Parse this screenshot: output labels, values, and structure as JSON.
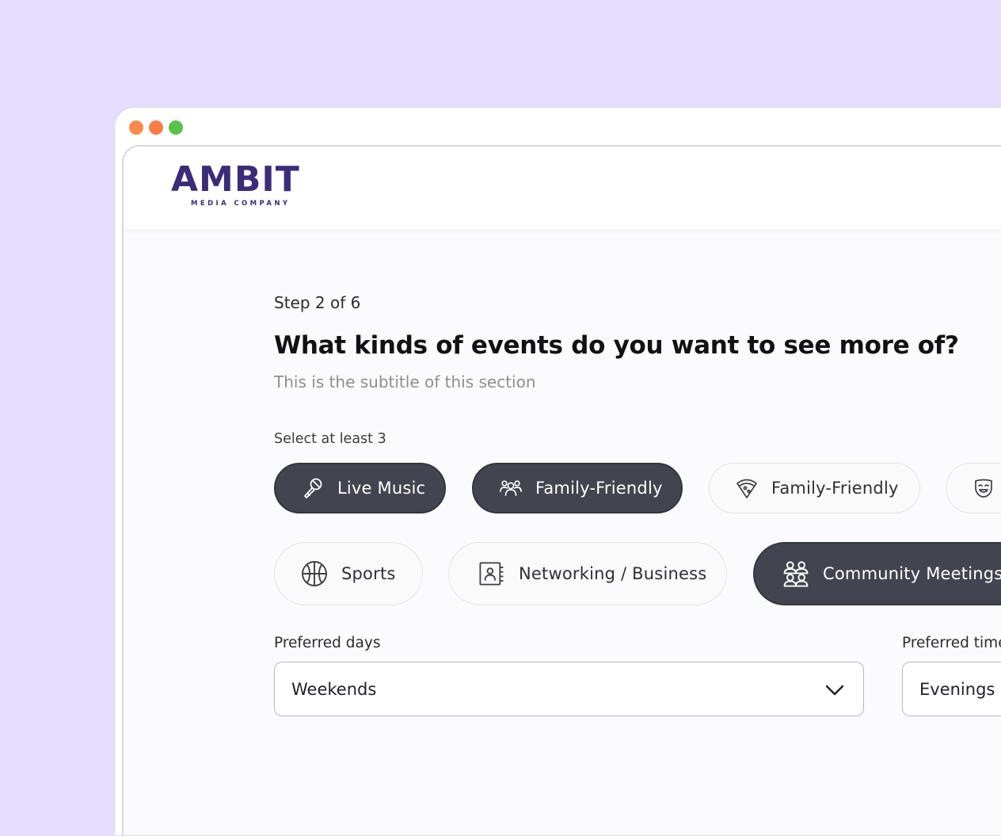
{
  "brand": {
    "name": "AMBIT",
    "tagline": "MEDIA COMPANY"
  },
  "form": {
    "step": "Step 2 of 6",
    "title": "What kinds of events do you want to see more of?",
    "subtitle": "This is the subtitle of this section",
    "hint": "Select at least 3",
    "chips": [
      {
        "label": "Live Music",
        "icon": "microphone-icon",
        "selected": true
      },
      {
        "label": "Family-Friendly",
        "icon": "people-group-icon",
        "selected": true
      },
      {
        "label": "Family-Friendly",
        "icon": "pizza-icon",
        "selected": false
      },
      {
        "label": "",
        "icon": "theater-mask-icon",
        "selected": false
      },
      {
        "label": "Sports",
        "icon": "basketball-icon",
        "selected": false
      },
      {
        "label": "Networking / Business",
        "icon": "contact-book-icon",
        "selected": false
      },
      {
        "label": "Community Meetings",
        "icon": "community-icon",
        "selected": true
      }
    ],
    "preferred_days": {
      "label": "Preferred days",
      "value": "Weekends"
    },
    "preferred_time": {
      "label": "Preferred time",
      "value": "Evenings"
    }
  },
  "colors": {
    "background": "#e6dcfd",
    "brand": "#3b2c7a",
    "chip_selected": "#42454f",
    "chip_unselected": "#fafafa"
  }
}
